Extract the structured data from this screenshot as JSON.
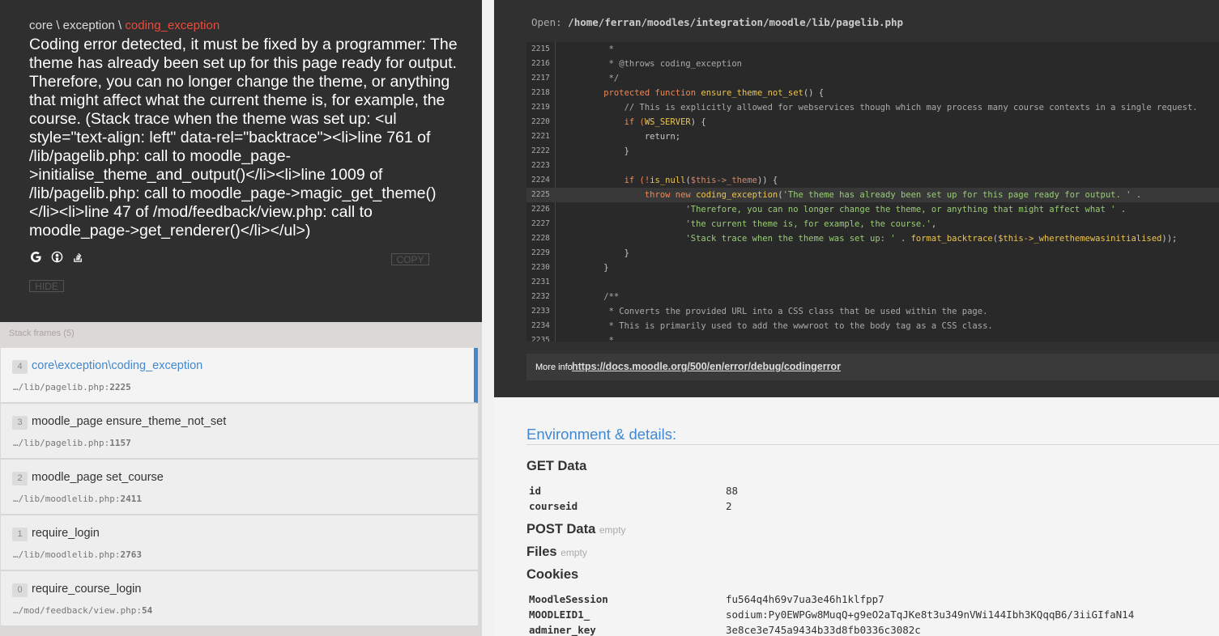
{
  "header": {
    "breadcrumb_ns": "core \\ exception \\",
    "breadcrumb_class": "coding_exception",
    "message": "Coding error detected, it must be fixed by a programmer: The theme has already been set up for this page ready for output. Therefore, you can no longer change the theme, or anything that might affect what the current theme is, for example, the course. (Stack trace when the theme was set up: <ul style=\"text-align: left\" data-rel=\"backtrace\"><li>line 761 of /lib/pagelib.php: call to moodle_page->initialise_theme_and_output()</li><li>line 1009 of /lib/pagelib.php: call to moodle_page->magic_get_theme()</li><li>line 47 of /mod/feedback/view.php: call to moodle_page->get_renderer()</li></ul>)",
    "copy_label": "COPY",
    "hide_label": "HIDE",
    "search_icons": [
      "google-icon",
      "duckduckgo-icon",
      "stackoverflow-icon"
    ]
  },
  "frames": {
    "header": "Stack frames (5)",
    "items": [
      {
        "index": "4",
        "class": "core\\exception\\coding_exception",
        "file": "…/lib/pagelib.php:",
        "line": "2225"
      },
      {
        "index": "3",
        "class": "moodle_page ensure_theme_not_set",
        "file": "…/lib/pagelib.php:",
        "line": "1157"
      },
      {
        "index": "2",
        "class": "moodle_page set_course",
        "file": "…/lib/moodlelib.php:",
        "line": "2411"
      },
      {
        "index": "1",
        "class": "require_login",
        "file": "…/lib/moodlelib.php:",
        "line": "2763"
      },
      {
        "index": "0",
        "class": "require_course_login",
        "file": "…/mod/feedback/view.php:",
        "line": "54"
      }
    ]
  },
  "code": {
    "open_label": "Open:",
    "path": "/home/ferran/moodles/integration/moodle/lib/pagelib.php",
    "more_info_label": "More info",
    "more_info_url": "https://docs.moodle.org/500/en/error/debug/codingerror",
    "line_numbers": [
      "2215",
      "2216",
      "2217",
      "2218",
      "2219",
      "2220",
      "2221",
      "2222",
      "2223",
      "2224",
      "2225",
      "2226",
      "2227",
      "2228",
      "2229",
      "2230",
      "2231",
      "2232",
      "2233",
      "2234",
      "2235"
    ],
    "l2215": "     *",
    "l2216": "     * @throws coding_exception",
    "l2217": "     */",
    "l2218_a": "    protected function ",
    "l2218_b": "ensure_theme_not_set",
    "l2218_c": "() {",
    "l2219": "        // This is explicitly allowed for webservices though which may process many course contexts in a single request.",
    "l2220_a": "        if (",
    "l2220_b": "WS_SERVER",
    "l2220_c": ") {",
    "l2221": "            return;",
    "l2222": "        }",
    "l2224_a": "        if (!",
    "l2224_b": "is_null",
    "l2224_c": "(",
    "l2224_d": "$this->_theme",
    "l2224_e": ")) {",
    "l2225_a": "            throw new ",
    "l2225_b": "coding_exception",
    "l2225_c": "(",
    "l2225_d": "'The theme has already been set up for this page ready for output. '",
    "l2225_e": " .",
    "l2226_a": "                    ",
    "l2226_b": "'Therefore, you can no longer change the theme, or anything that might affect what '",
    "l2226_c": " .",
    "l2227_a": "                    ",
    "l2227_b": "'the current theme is, for example, the course.'",
    "l2227_c": ",",
    "l2228_a": "                    ",
    "l2228_b": "'Stack trace when the theme was set up: '",
    "l2228_c": " . ",
    "l2228_d": "format_backtrace",
    "l2228_e": "(",
    "l2228_f": "$this->_wherethemewasinitialised",
    "l2228_g": "));",
    "l2229": "        }",
    "l2230": "    }",
    "l2232": "    /**",
    "l2233": "     * Converts the provided URL into a CSS class that be used within the page.",
    "l2234": "     * This is primarily used to add the wwwroot to the body tag as a CSS class.",
    "l2235": "     *"
  },
  "env": {
    "title": "Environment & details:",
    "get_title": "GET Data",
    "get": [
      {
        "k": "id",
        "v": "88"
      },
      {
        "k": "courseid",
        "v": "2"
      }
    ],
    "post_title": "POST Data",
    "post_empty": "empty",
    "files_title": "Files",
    "files_empty": "empty",
    "cookies_title": "Cookies",
    "cookies": [
      {
        "k": "MoodleSession",
        "v": "fu564q4h69v7ua3e46h1klfpp7"
      },
      {
        "k": "MOODLEID1_",
        "v": "sodium:Py0EWPGw8MuqQ+g9eO2aTqJKe8t3u349nVWi144Ibh3KQqqB6/3iiGIfaN14"
      },
      {
        "k": "adminer_key",
        "v": "3e8ce3e745a9434b33d8fb0336c3082c"
      }
    ]
  }
}
